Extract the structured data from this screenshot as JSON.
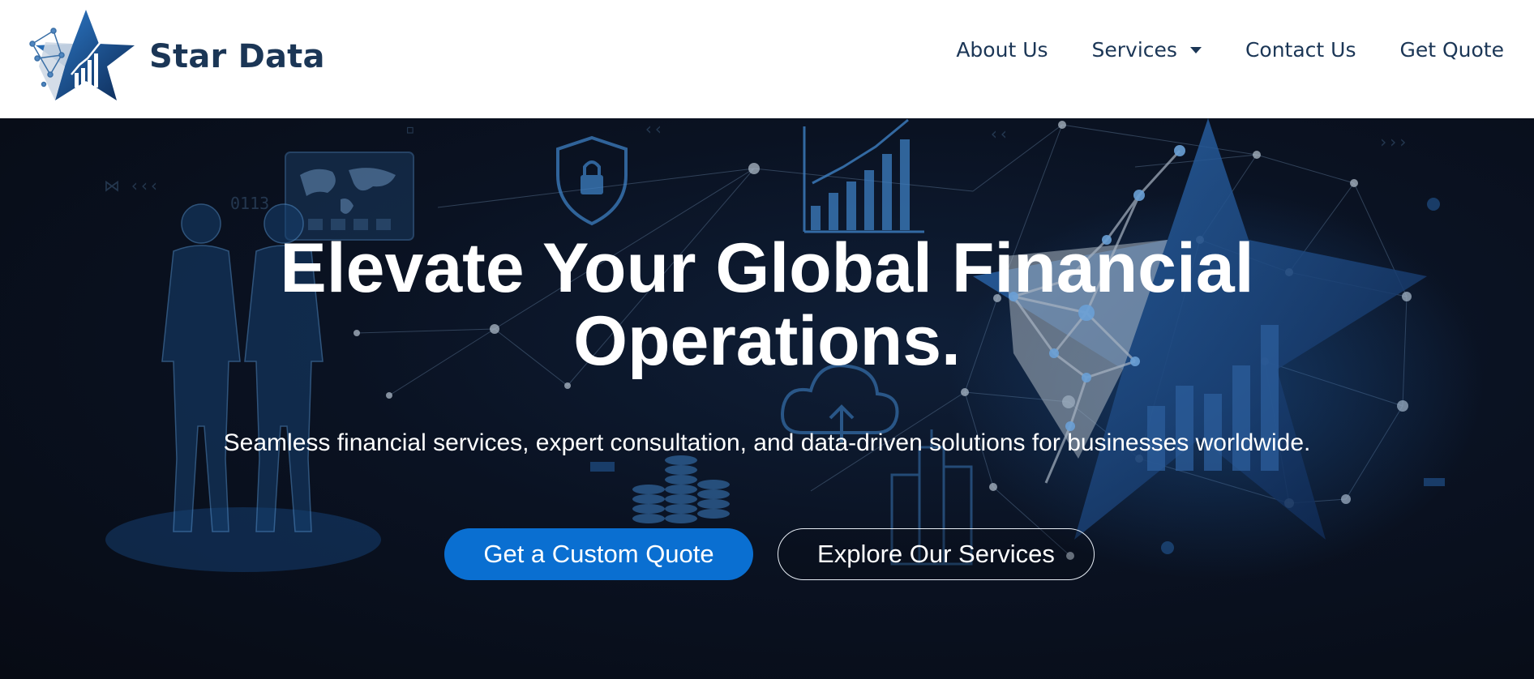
{
  "brand": {
    "name": "Star Data",
    "logo_icon": "star-chart-icon",
    "colors": {
      "navy": "#1b3656",
      "accent": "#0a6fd1",
      "hero_bg": "#070b14"
    }
  },
  "nav": {
    "items": [
      {
        "label": "About Us"
      },
      {
        "label": "Services",
        "has_dropdown": true
      },
      {
        "label": "Contact Us"
      },
      {
        "label": "Get Quote"
      }
    ]
  },
  "hero": {
    "title_line1": "Elevate Your Global Financial",
    "title_line2": "Operations.",
    "subtitle": "Seamless financial services, expert consultation, and data-driven solutions for businesses worldwide.",
    "primary_button": "Get a Custom Quote",
    "secondary_button": "Explore Our Services",
    "background_icons": [
      "business-people-hologram",
      "world-map-icon",
      "lock-shield-icon",
      "growth-chart-icon",
      "cloud-upload-icon",
      "coin-stack-icon",
      "city-buildings-icon",
      "network-star-icon"
    ]
  }
}
